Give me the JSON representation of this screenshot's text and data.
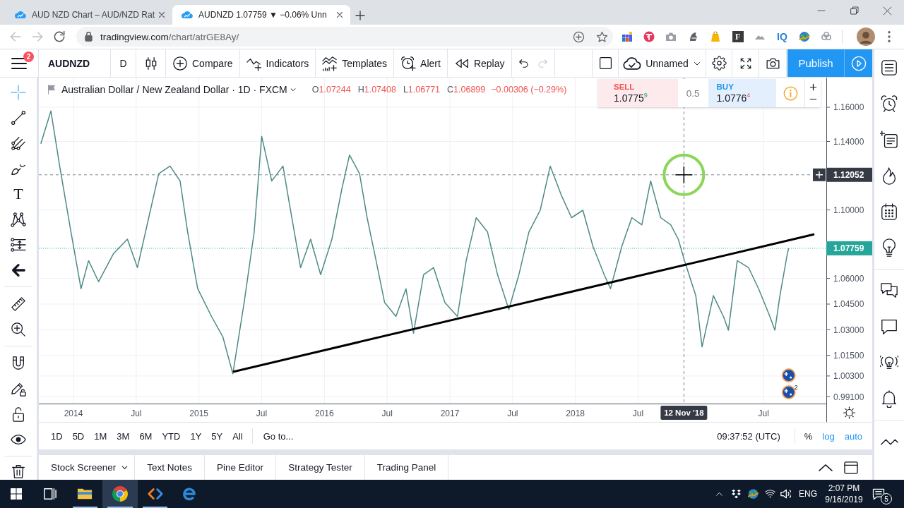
{
  "browser": {
    "tabs": [
      {
        "title": "AUD NZD Chart – AUD/NZD Rat",
        "selected": false
      },
      {
        "title": "AUDNZD 1.07759 ▼ −0.06% Unn",
        "selected": true
      }
    ],
    "url": {
      "host": "tradingview.com",
      "path": "/chart/atrGE8Ay/"
    },
    "extensions": [
      {
        "kind": "tiles"
      },
      {
        "kind": "badge"
      },
      {
        "kind": "camera"
      },
      {
        "kind": "helmet"
      },
      {
        "kind": "bag"
      },
      {
        "kind": "letter",
        "label": "F"
      },
      {
        "kind": "cloud"
      },
      {
        "kind": "wordmark",
        "label": "IQ"
      },
      {
        "kind": "globe"
      },
      {
        "kind": "rings"
      }
    ]
  },
  "toolbar": {
    "menu_badge": "2",
    "symbol": "AUDNZD",
    "interval": "D",
    "buttons": [
      {
        "kind": "compare",
        "label": "Compare"
      },
      {
        "kind": "indicators",
        "label": "Indicators"
      },
      {
        "kind": "templates",
        "label": "Templates"
      },
      {
        "kind": "alert",
        "label": "Alert"
      },
      {
        "kind": "replay",
        "label": "Replay"
      }
    ],
    "history": [
      {
        "kind": "undo",
        "disabled": false
      },
      {
        "kind": "redo",
        "disabled": true
      }
    ],
    "layout_name": "Unnamed",
    "publish": "Publish"
  },
  "drawing_tools": [
    {
      "tools": [
        {
          "kind": "crosshair",
          "selected": true
        },
        {
          "kind": "trend-line",
          "selected": false
        },
        {
          "kind": "pitchfork",
          "selected": false
        },
        {
          "kind": "brush",
          "selected": false
        },
        {
          "kind": "text",
          "glyph": "T",
          "selected": false
        },
        {
          "kind": "pattern",
          "selected": false
        },
        {
          "kind": "projection",
          "selected": false
        },
        {
          "kind": "arrow",
          "selected": false
        }
      ]
    },
    {
      "tools": [
        {
          "kind": "ruler",
          "selected": false
        },
        {
          "kind": "zoom",
          "selected": false
        }
      ]
    },
    {
      "tools": [
        {
          "kind": "magnet",
          "selected": false
        },
        {
          "kind": "lock-drawing",
          "selected": false
        },
        {
          "kind": "lock",
          "selected": false
        },
        {
          "kind": "eye",
          "selected": false
        }
      ]
    },
    {
      "tools": [
        {
          "kind": "trash",
          "selected": false
        }
      ]
    }
  ],
  "chart": {
    "legend": {
      "title": "Australian Dollar / New Zealand Dollar · 1D · FXCM",
      "down": true,
      "ohlc": [
        {
          "label": "O",
          "value": "1.07244"
        },
        {
          "label": "H",
          "value": "1.07408"
        },
        {
          "label": "L",
          "value": "1.06771"
        },
        {
          "label": "C",
          "value": "1.06899"
        }
      ],
      "change": "−0.00306 (−0.29%)"
    },
    "trade": {
      "sell_label": "SELL",
      "sell_price": "1.0775$^{9}$",
      "spread": "0.5",
      "buy_label": "BUY",
      "buy_price": "1.0776$^{4}$"
    },
    "chart_data": {
      "type": "line",
      "x": [
        2013.74,
        2013.82,
        2013.89,
        2013.98,
        2014.06,
        2014.12,
        2014.2,
        2014.32,
        2014.43,
        2014.51,
        2014.6,
        2014.68,
        2014.77,
        2014.85,
        2014.91,
        2014.99,
        2015.1,
        2015.19,
        2015.27,
        2015.36,
        2015.44,
        2015.5,
        2015.58,
        2015.67,
        2015.72,
        2015.81,
        2015.89,
        2015.97,
        2016.06,
        2016.14,
        2016.2,
        2016.28,
        2016.34,
        2016.4,
        2016.48,
        2016.57,
        2016.65,
        2016.71,
        2016.79,
        2016.87,
        2016.96,
        2017.06,
        2017.13,
        2017.21,
        2017.3,
        2017.38,
        2017.47,
        2017.55,
        2017.63,
        2017.72,
        2017.8,
        2017.89,
        2017.97,
        2018.06,
        2018.14,
        2018.23,
        2018.28,
        2018.37,
        2018.45,
        2018.53,
        2018.6,
        2018.68,
        2018.76,
        2018.82,
        2018.87,
        2018.96,
        2019.01,
        2019.1,
        2019.18,
        2019.22,
        2019.29,
        2019.38,
        2019.46,
        2019.55,
        2019.59,
        2019.63,
        2019.69,
        2019.7
      ],
      "series": [
        {
          "color": "#4e8a84",
          "values": [
            1.1387,
            1.1578,
            1.1256,
            1.0871,
            1.054,
            1.0704,
            1.0581,
            1.0746,
            1.0829,
            1.0663,
            1.0955,
            1.1212,
            1.1256,
            1.1169,
            1.0871,
            1.054,
            1.0378,
            1.0259,
            1.0043,
            1.0459,
            1.0871,
            1.143,
            1.1169,
            1.1256,
            1.104,
            1.0663,
            1.0829,
            1.0622,
            1.0829,
            1.1126,
            1.1321,
            1.1212,
            1.0955,
            1.0746,
            1.0459,
            1.0378,
            1.054,
            1.028,
            1.0622,
            1.0663,
            1.0459,
            1.0378,
            1.0704,
            1.0955,
            1.0871,
            1.0622,
            1.0418,
            1.0622,
            1.0871,
            1.0998,
            1.1256,
            1.1083,
            1.0955,
            1.0998,
            1.0787,
            1.0622,
            1.054,
            1.0787,
            1.0955,
            1.0913,
            1.1169,
            1.0955,
            1.0913,
            1.0829,
            1.0704,
            1.0499,
            1.02,
            1.0499,
            1.0378,
            1.0298,
            1.0704,
            1.0663,
            1.054,
            1.0378,
            1.0298,
            1.0499,
            1.0746,
            1.0776
          ]
        }
      ],
      "xlim": [
        2013.724,
        2020.0
      ],
      "ylim": [
        0.98688,
        1.1773
      ],
      "grid": true,
      "xticks": [
        {
          "value": 2014,
          "label": "2014"
        },
        {
          "value": 2014.5,
          "label": "Jul"
        },
        {
          "value": 2015,
          "label": "2015"
        },
        {
          "value": 2015.5,
          "label": "Jul"
        },
        {
          "value": 2016,
          "label": "2016"
        },
        {
          "value": 2016.5,
          "label": "Jul"
        },
        {
          "value": 2017,
          "label": "2017"
        },
        {
          "value": 2017.5,
          "label": "Jul"
        },
        {
          "value": 2018,
          "label": "2018"
        },
        {
          "value": 2018.5,
          "label": "Jul"
        },
        {
          "value": 2019.5,
          "label": "Jul"
        }
      ],
      "yticks": [
        {
          "value": 1.16,
          "label": "1.16000"
        },
        {
          "value": 1.14,
          "label": "1.14000"
        },
        {
          "value": 1.1,
          "label": "1.10000"
        },
        {
          "value": 1.06,
          "label": "1.06000"
        },
        {
          "value": 1.045,
          "label": "1.04500"
        },
        {
          "value": 1.03,
          "label": "1.03000"
        },
        {
          "value": 1.015,
          "label": "1.01500"
        },
        {
          "value": 1.003,
          "label": "1.00300"
        },
        {
          "value": 0.991,
          "label": "0.99100"
        }
      ],
      "ref_lines": [
        {
          "axis": "y",
          "value": 1.07759,
          "label": "1.07759",
          "color": "#26a69a"
        },
        {
          "axis": "y",
          "value": 1.12052,
          "label": "1.12052",
          "color": "#758696"
        },
        {
          "axis": "x",
          "value": 2018.865,
          "label": "12 Nov '18",
          "color": "#758696"
        }
      ]
    },
    "event_markers": [
      {
        "kind": "flag"
      },
      {
        "kind": "flag",
        "count": "2"
      }
    ]
  },
  "range_bar": {
    "ranges": [
      "1D",
      "5D",
      "1M",
      "3M",
      "6M",
      "YTD",
      "1Y",
      "5Y",
      "All"
    ],
    "goto": "Go to...",
    "clock": "09:37:52 (UTC)",
    "toggles": [
      {
        "label": "%",
        "on": false
      },
      {
        "label": "log",
        "on": true
      },
      {
        "label": "auto",
        "on": true
      }
    ]
  },
  "panel_tabs": [
    {
      "label": "Stock Screener",
      "dropdown": true
    },
    {
      "label": "Text Notes",
      "dropdown": false
    },
    {
      "label": "Pine Editor",
      "dropdown": false
    },
    {
      "label": "Strategy Tester",
      "dropdown": false
    },
    {
      "label": "Trading Panel",
      "dropdown": false
    }
  ],
  "taskbar": {
    "apps": [
      {
        "kind": "explorer",
        "selected": false,
        "running": true
      },
      {
        "kind": "chrome",
        "selected": true,
        "running": true
      },
      {
        "kind": "code",
        "selected": false,
        "running": true
      },
      {
        "kind": "edge",
        "selected": false,
        "running": false
      }
    ],
    "language": "ENG",
    "time": "2:07 PM",
    "date": "9/16/2019",
    "notifications": "5"
  }
}
